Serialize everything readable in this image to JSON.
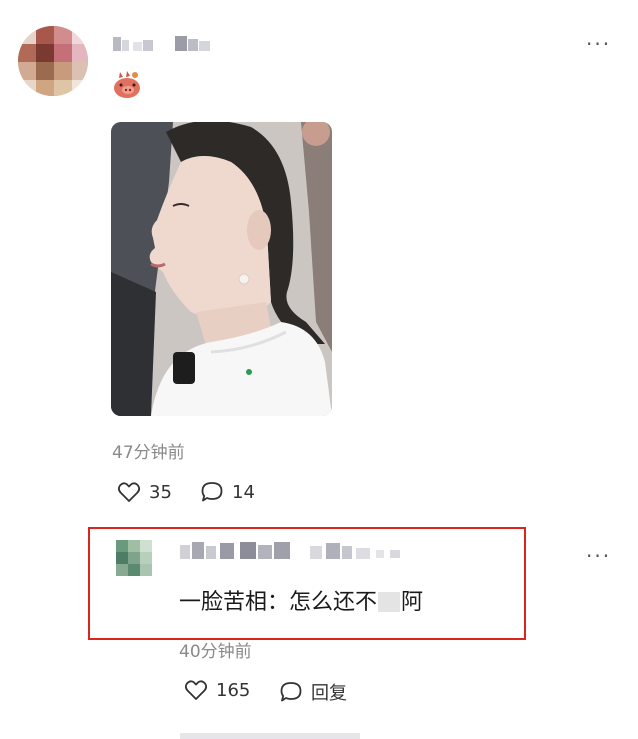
{
  "post": {
    "menu_icon": "more-horizontal-icon",
    "badge_icon": "pig-emoji-icon",
    "time": "47分钟前",
    "likes": "35",
    "comments": "14",
    "like_icon": "heart-icon",
    "comment_icon": "comment-bubble-icon"
  },
  "comment": {
    "text_before": "一脸苦相：怎么还不",
    "text_after": "阿",
    "time": "40分钟前",
    "likes": "165",
    "reply_label": "回复",
    "highlight_color": "#d9251c"
  }
}
